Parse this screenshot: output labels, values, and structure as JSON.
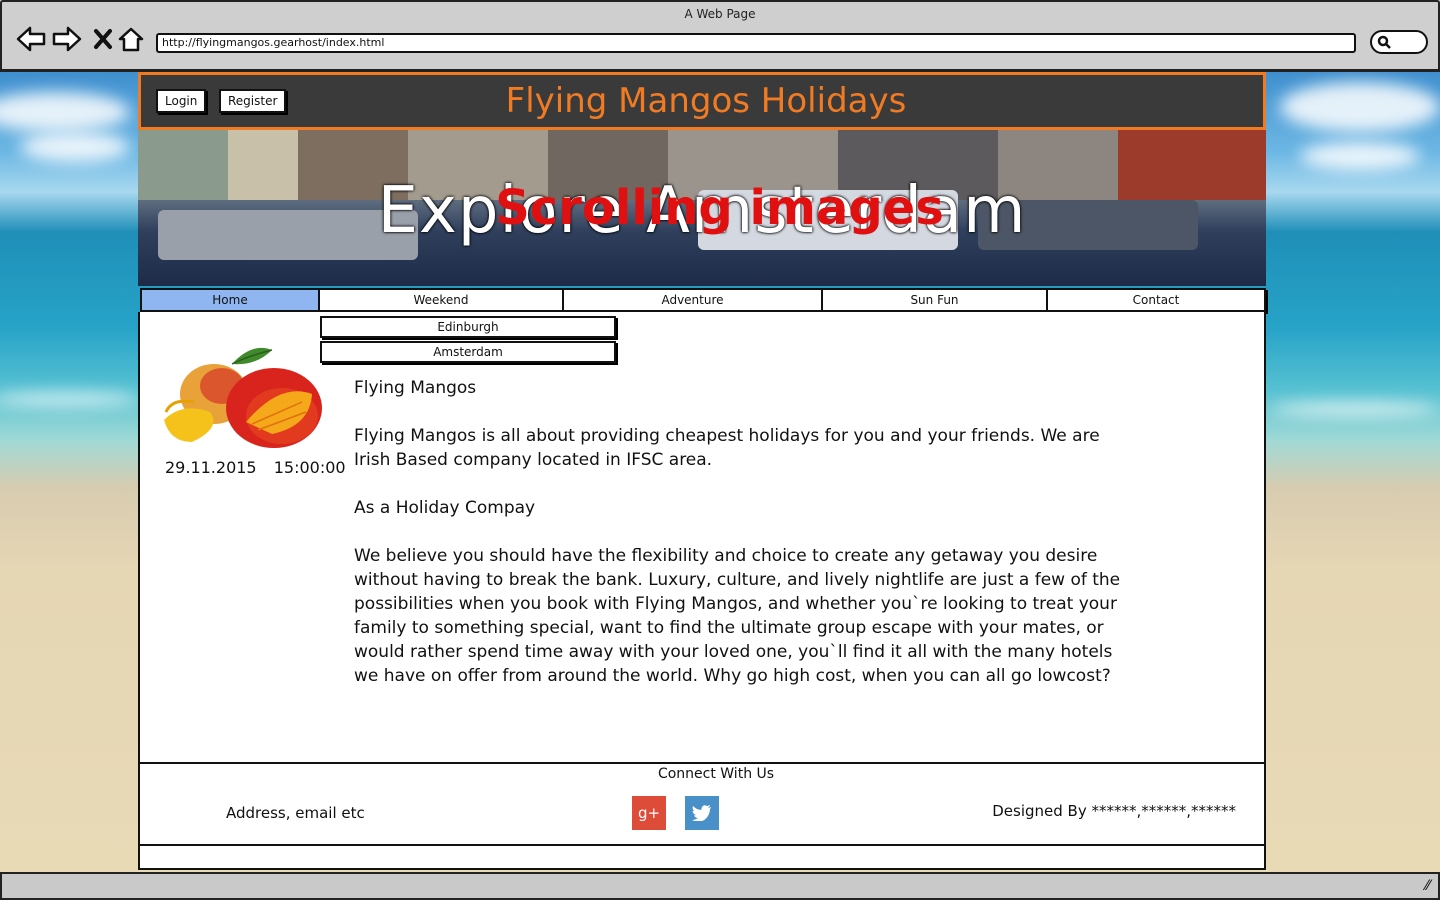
{
  "browser": {
    "window_title": "A Web Page",
    "url": "http://flyingmangos.gearhost/index.html",
    "icons": [
      "back-arrow-icon",
      "forward-arrow-icon",
      "close-x-icon",
      "home-icon",
      "search-icon"
    ]
  },
  "header": {
    "login_label": "Login",
    "register_label": "Register",
    "site_title": "Flying Mangos Holidays",
    "accent_color": "#f07b22"
  },
  "banner": {
    "caption": "Explore Amsterdam",
    "overlay_note": "Scrolling images",
    "overlay_color": "#e01010"
  },
  "menu": {
    "items": [
      "Home",
      "Weekend",
      "Adventure",
      "Sun Fun",
      "Contact"
    ],
    "active": "Home",
    "active_color": "#8fb6f0",
    "submenu": [
      "Edinburgh",
      "Amsterdam"
    ]
  },
  "sidebar": {
    "date": "29.11.2015",
    "time": "15:00:00"
  },
  "article": {
    "heading": "Flying Mangos",
    "intro": "Flying Mangos is all about providing cheapest holidays for you and your friends. We are Irish Based company located in IFSC area.",
    "subheading": "As a Holiday Compay",
    "body": "We believe you should have the flexibility and choice to create any getaway you desire without having to break the bank. Luxury, culture, and lively nightlife are just a few of the possibilities when you book with Flying Mangos, and whether you`re looking to treat your family to something special, want to find the ultimate group escape with your mates, or would rather spend time away with your loved one, you`ll find it all with the many hotels we have on offer from around the world. Why go high cost, when you can all go lowcost?"
  },
  "footer": {
    "title": "Connect With Us",
    "address": "Address, email etc",
    "designed_by": "Designed By ******,******,******",
    "social": [
      {
        "name": "google-plus-icon",
        "glyph": "g+",
        "color": "#dd4b39"
      },
      {
        "name": "twitter-icon",
        "glyph": "🐦",
        "color": "#4a90c8"
      }
    ]
  }
}
